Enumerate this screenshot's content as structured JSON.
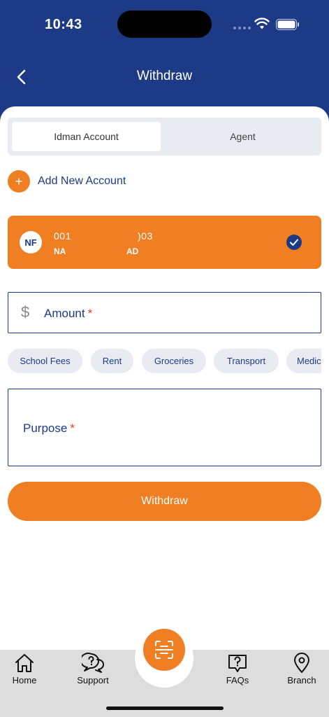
{
  "status_bar": {
    "time": "10:43"
  },
  "header": {
    "title": "Withdraw"
  },
  "segmented": {
    "tabs": [
      "Idman Account",
      "Agent"
    ]
  },
  "add_account": {
    "icon": "+",
    "label": "Add New Account"
  },
  "account": {
    "initials": "NF",
    "number_part1": "001",
    "number_part2": ")03",
    "name_part1": "NA",
    "name_part2": "AD"
  },
  "amount": {
    "symbol": "$",
    "label": "Amount",
    "required": "*"
  },
  "chips": [
    "School Fees",
    "Rent",
    "Groceries",
    "Transport",
    "Medic"
  ],
  "purpose": {
    "label": "Purpose",
    "required": "*"
  },
  "withdraw_button": {
    "label": "Withdraw"
  },
  "tabbar": {
    "items": [
      "Home",
      "Support",
      "FAQs",
      "Branch"
    ]
  },
  "colors": {
    "brand": "#1d3a87",
    "accent": "#f07e22",
    "required": "#e53935"
  }
}
